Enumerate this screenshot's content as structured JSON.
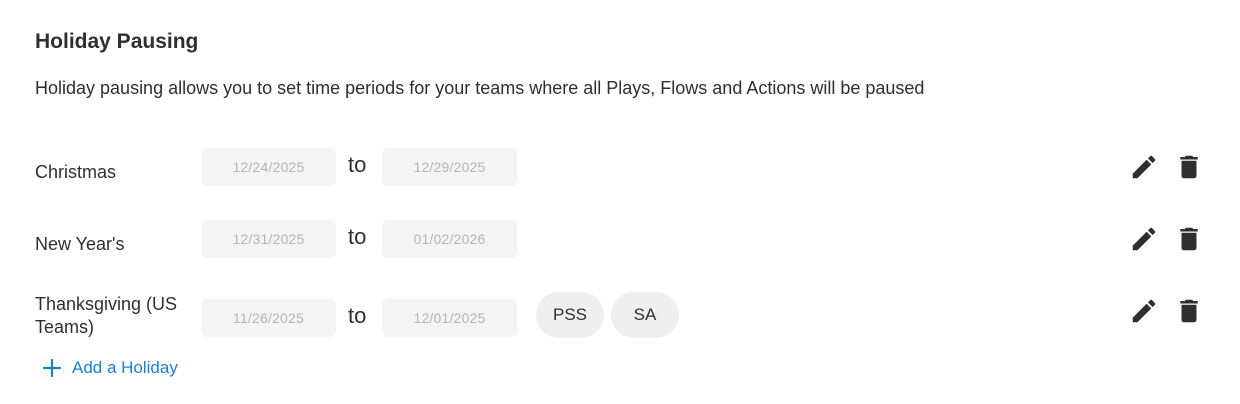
{
  "section": {
    "title": "Holiday Pausing",
    "description": "Holiday pausing allows you to set time periods for your teams where all Plays, Flows and Actions will be paused"
  },
  "holidays": [
    {
      "name": "Christmas",
      "start": "12/24/2025",
      "separator": "to",
      "end": "12/29/2025",
      "teams": []
    },
    {
      "name": "New Year's",
      "start": "12/31/2025",
      "separator": "to",
      "end": "01/02/2026",
      "teams": []
    },
    {
      "name": "Thanksgiving (US Teams)",
      "start": "11/26/2025",
      "separator": "to",
      "end": "12/01/2025",
      "teams": [
        "PSS",
        "SA"
      ]
    }
  ],
  "actions": {
    "add_label": "Add a Holiday",
    "edit_icon": "pencil-icon",
    "delete_icon": "trash-icon",
    "add_icon": "plus-icon"
  },
  "colors": {
    "accent": "#1a7fd4",
    "field_bg": "#f4f4f4",
    "chip_bg": "#efefef",
    "icon": "#2f2f2f"
  }
}
